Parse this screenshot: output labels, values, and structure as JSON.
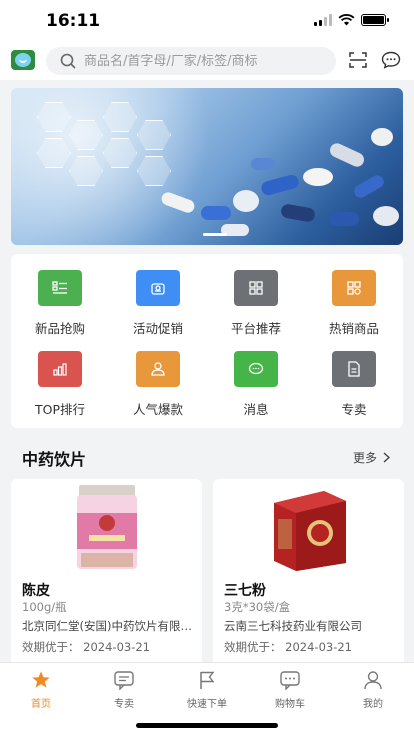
{
  "status": {
    "time": "16:11"
  },
  "search": {
    "placeholder": "商品名/首字母/厂家/标签/商标"
  },
  "quick_menu": [
    {
      "label": "新品抢购",
      "icon": "list-icon",
      "color": "#4caf50"
    },
    {
      "label": "活动促销",
      "icon": "gift-icon",
      "color": "#3f8ef5"
    },
    {
      "label": "平台推荐",
      "icon": "grid-icon",
      "color": "#6d7075"
    },
    {
      "label": "热销商品",
      "icon": "hot-grid-icon",
      "color": "#e8973a"
    },
    {
      "label": "TOP排行",
      "icon": "bar-chart-icon",
      "color": "#d9534f"
    },
    {
      "label": "人气爆款",
      "icon": "people-icon",
      "color": "#e8973a"
    },
    {
      "label": "消息",
      "icon": "chat-icon",
      "color": "#45b549"
    },
    {
      "label": "专卖",
      "icon": "document-icon",
      "color": "#6d7075"
    }
  ],
  "section": {
    "title": "中药饮片",
    "more_label": "更多"
  },
  "products": [
    {
      "name": "陈皮",
      "spec": "100g/瓶",
      "manufacturer": "北京同仁堂(安国)中药饮片有限公司",
      "expiry": "效期优于：  2024-03-21"
    },
    {
      "name": "三七粉",
      "spec": "3克*30袋/盒",
      "manufacturer": "云南三七科技药业有限公司",
      "expiry": "效期优于：  2024-03-21"
    }
  ],
  "tabbar": [
    {
      "label": "首页",
      "icon": "home-star-icon",
      "active": true
    },
    {
      "label": "专卖",
      "icon": "shop-chat-icon",
      "active": false
    },
    {
      "label": "快速下单",
      "icon": "flag-icon",
      "active": false
    },
    {
      "label": "购物车",
      "icon": "cart-chat-icon",
      "active": false
    },
    {
      "label": "我的",
      "icon": "user-icon",
      "active": false
    }
  ],
  "colors": {
    "accent": "#f08a24"
  }
}
